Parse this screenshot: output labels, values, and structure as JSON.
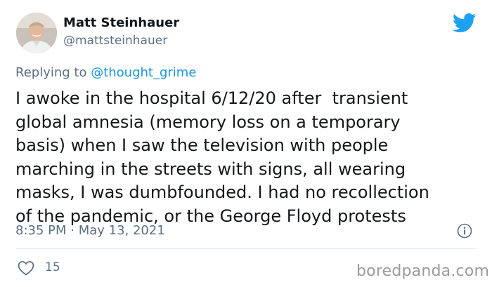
{
  "author": {
    "name": "Matt Steinhauer",
    "handle": "@mattsteinhauer"
  },
  "reply": {
    "prefix": "Replying to ",
    "mention": "@thought_grime"
  },
  "tweet": {
    "text": "I awoke in the hospital 6/12/20 after  transient\nglobal amnesia (memory loss on a temporary\nbasis) when I saw the television with people\nmarching in the streets with signs, all wearing\nmasks, I was dumbfounded. I had no recollection\nof the pandemic, or the George Floyd protests",
    "timestamp": "8:35 PM · May 13, 2021",
    "likes": "15"
  },
  "icons": {
    "logo": "twitter-bird-icon",
    "info": "info-icon",
    "like": "heart-icon"
  },
  "colors": {
    "brand": "#1da1f2",
    "link": "#1b95e0",
    "secondary_text": "#5b7083",
    "divider": "#e1e8ed"
  },
  "watermark": "boredpanda.com"
}
